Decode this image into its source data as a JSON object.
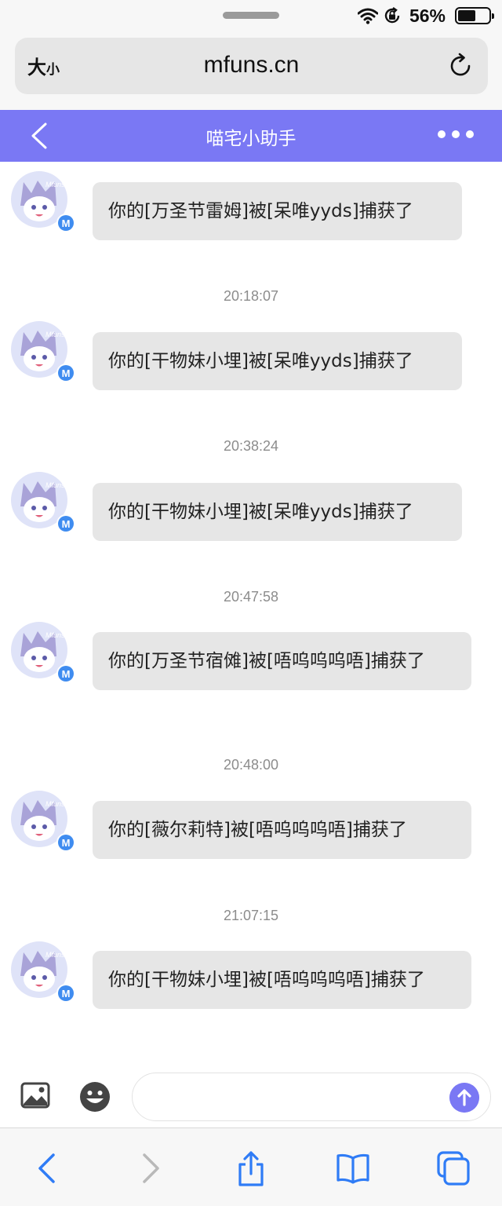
{
  "status_bar": {
    "battery_percent": "56%"
  },
  "url_bar": {
    "text_size_big": "大",
    "text_size_small": "小",
    "domain": "mfuns.cn"
  },
  "header": {
    "title": "喵宅小助手"
  },
  "messages": [
    {
      "text": "你的[万圣节雷姆]被[呆唯yyds]捕获了"
    },
    {
      "text": "你的[干物妹小埋]被[呆唯yyds]捕获了"
    },
    {
      "text": "你的[干物妹小埋]被[呆唯yyds]捕获了"
    },
    {
      "text": "你的[万圣节宿傩]被[唔呜呜呜唔]捕获了"
    },
    {
      "text": "你的[薇尔莉特]被[唔呜呜呜唔]捕获了"
    },
    {
      "text": "你的[干物妹小埋]被[唔呜呜呜唔]捕获了"
    }
  ],
  "timestamps": [
    "20:18:07",
    "20:38:24",
    "20:47:58",
    "20:48:00",
    "21:07:15"
  ],
  "avatar": {
    "badge_letter": "M",
    "logo_text": "Mfuns"
  },
  "colors": {
    "header": "#7a78f4",
    "bubble": "#e6e6e6",
    "timestamp": "#8c8c8c"
  }
}
